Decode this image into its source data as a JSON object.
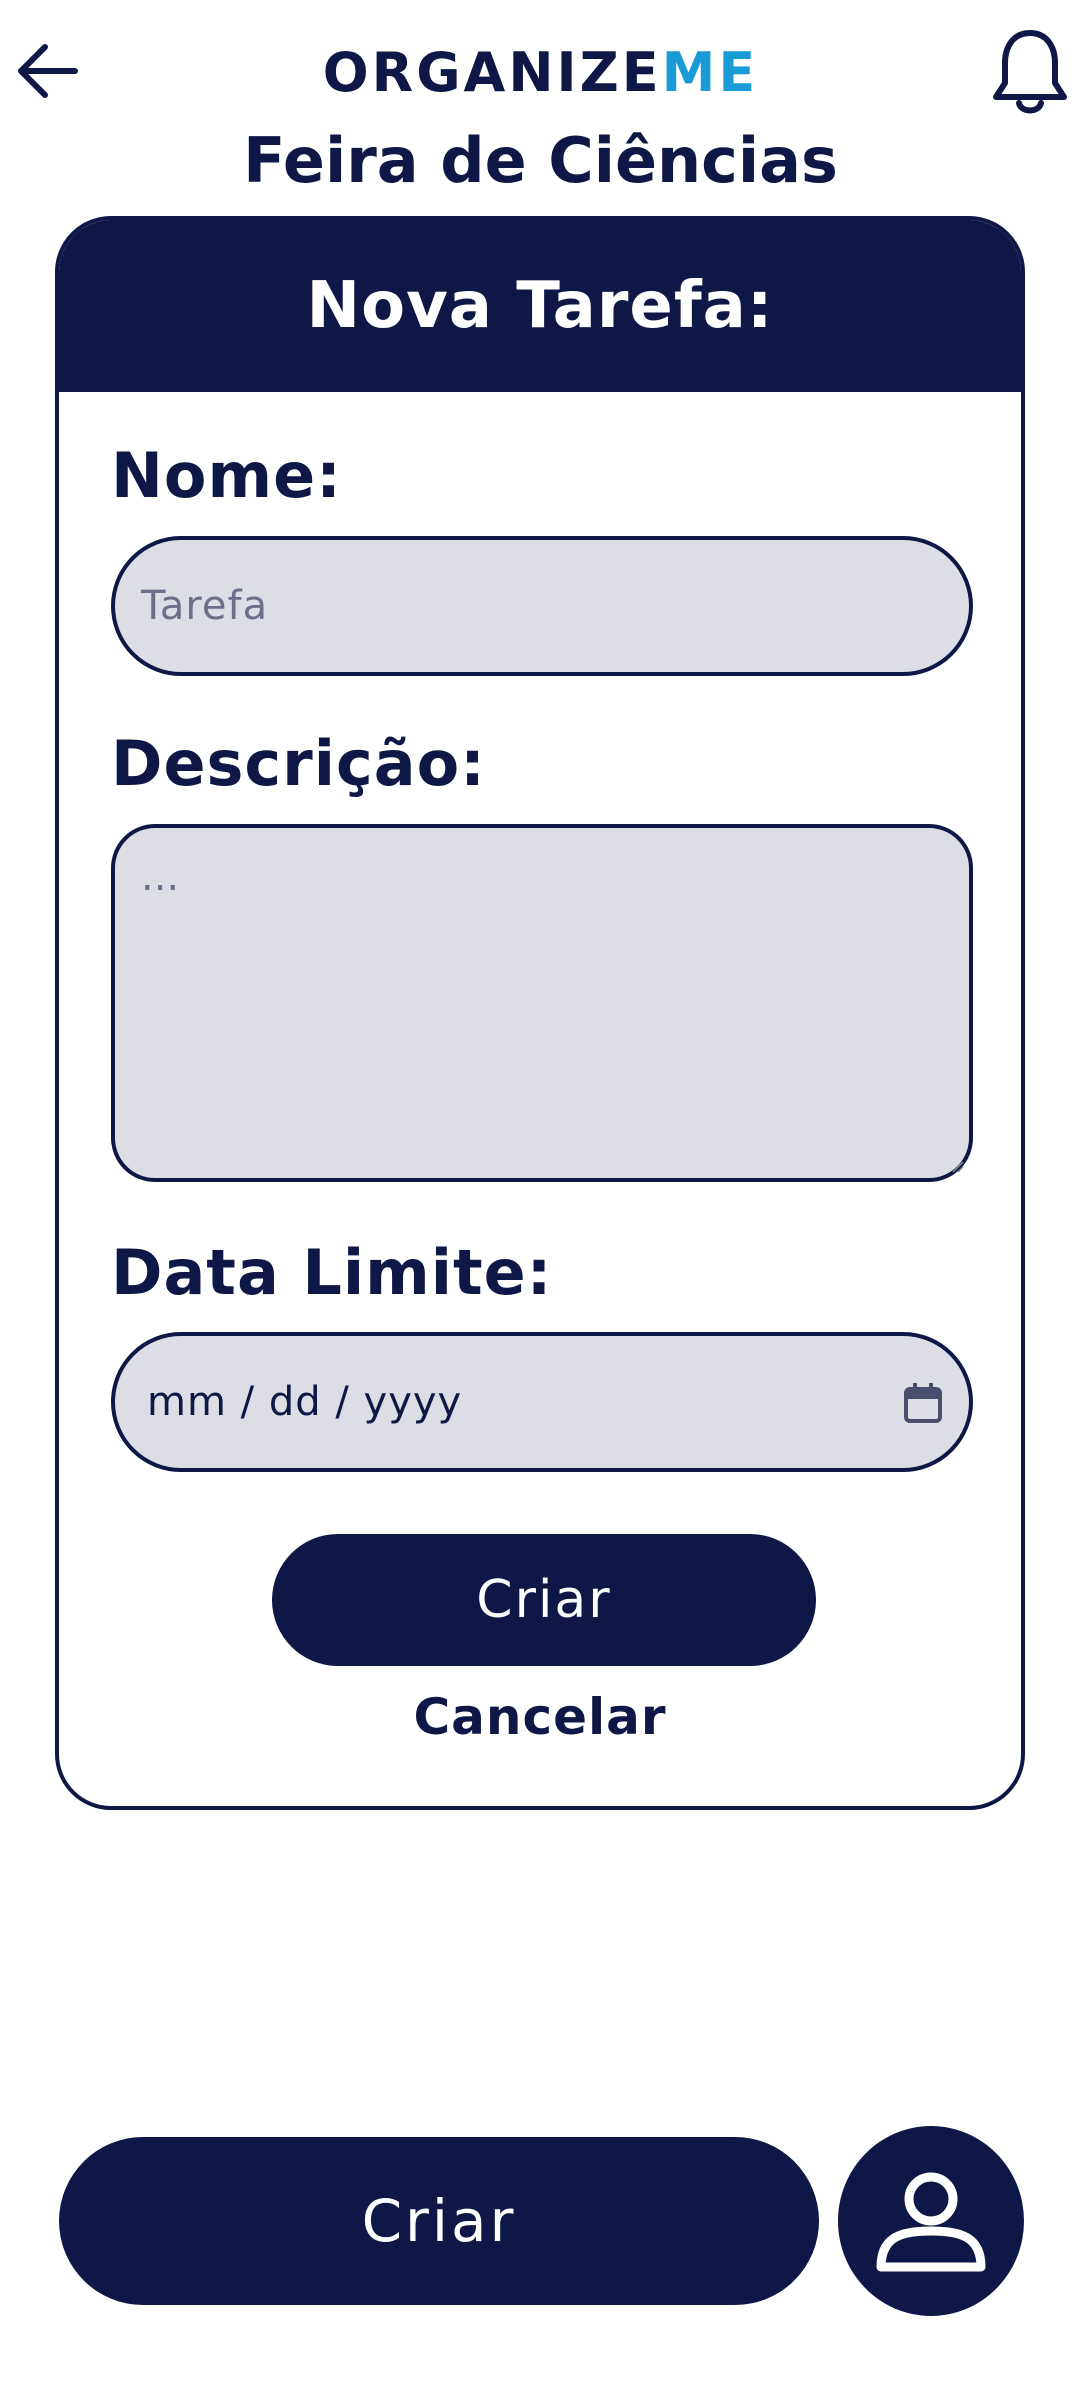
{
  "header": {
    "logo_part1": "ORGANIZE",
    "logo_part2": "ME",
    "project_title": "Feira de Ciências",
    "back_icon": "arrow-left-icon",
    "bell_icon": "bell-icon"
  },
  "card": {
    "title": "Nova Tarefa:",
    "name_label": "Nome:",
    "name_placeholder": "Tarefa",
    "description_label": "Descrição:",
    "description_placeholder": "...",
    "deadline_label": "Data Limite:",
    "deadline_placeholder": "mm / dd / yyyy",
    "calendar_icon": "calendar-icon",
    "create_label": "Criar",
    "cancel_label": "Cancelar"
  },
  "bottom": {
    "create_label": "Criar",
    "profile_icon": "user-icon"
  },
  "colors": {
    "primary": "#0e1745",
    "accent": "#1a9ad6",
    "input_bg": "#dcdde5",
    "placeholder": "#6c6f88",
    "background": "#ffffff"
  }
}
